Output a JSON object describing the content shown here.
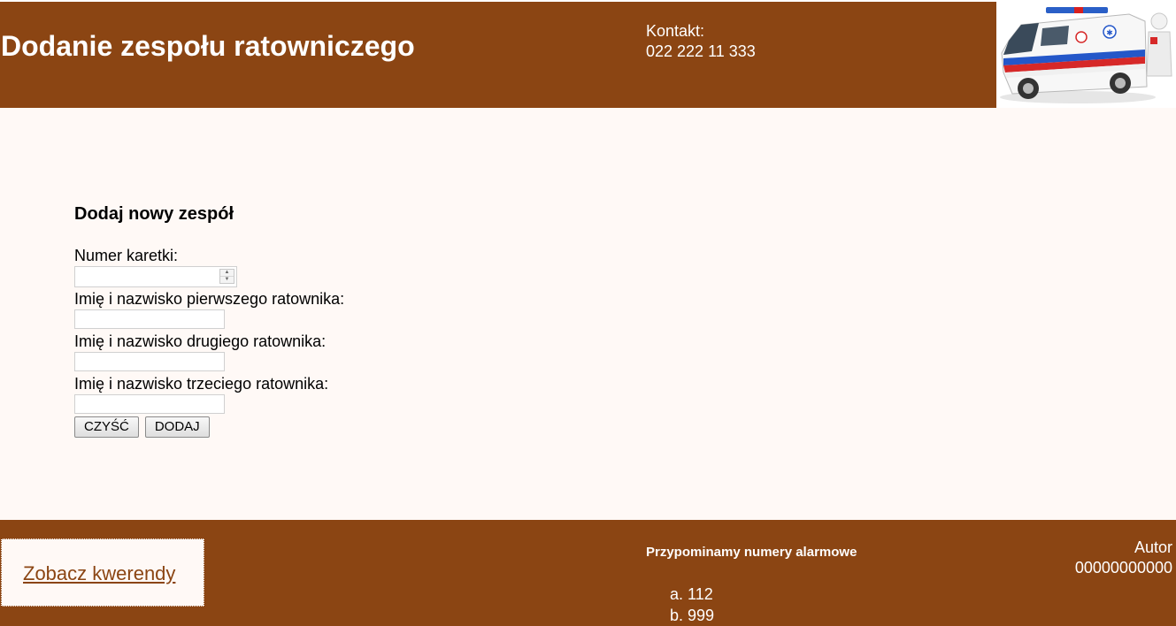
{
  "header": {
    "title": "Dodanie zespołu ratowniczego",
    "contact_label": "Kontakt:",
    "contact_phone": "022 222 11 333",
    "logo_icon": "ambulance-image"
  },
  "form": {
    "heading": "Dodaj nowy zespół",
    "fields": [
      {
        "label": "Numer karetki:",
        "value": ""
      },
      {
        "label": "Imię i nazwisko pierwszego ratownika:",
        "value": ""
      },
      {
        "label": "Imię i nazwisko drugiego ratownika:",
        "value": ""
      },
      {
        "label": "Imię i nazwisko trzeciego ratownika:",
        "value": ""
      }
    ],
    "clear_label": "CZYŚĆ",
    "submit_label": "DODAJ"
  },
  "footer": {
    "query_link": "Zobacz kwerendy",
    "reminder": "Przypominamy numery alarmowe",
    "alarm_numbers": [
      "a. 112",
      "b. 999"
    ],
    "author_label": "Autor",
    "author_value": "00000000000"
  },
  "colors": {
    "brand": "#8b4513",
    "background": "#fff9f6"
  }
}
